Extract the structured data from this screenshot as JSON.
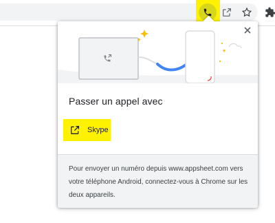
{
  "toolbar": {
    "icons": [
      "phone-icon",
      "share-icon",
      "star-icon",
      "puzzle-icon"
    ],
    "highlight_color": "#fff200"
  },
  "bubble": {
    "title": "Passer un appel avec",
    "options": [
      {
        "label": "Skype",
        "icon": "open-in-new-icon"
      }
    ],
    "footer_text": "Pour envoyer un numéro depuis www.appsheet.com vers votre téléphone Android, connectez-vous à Chrome sur les deux appareils."
  },
  "colors": {
    "accent_blue": "#4285f4",
    "red": "#ea4335",
    "yellow_sparkle": "#fbbc04",
    "highlight": "#fff200"
  }
}
